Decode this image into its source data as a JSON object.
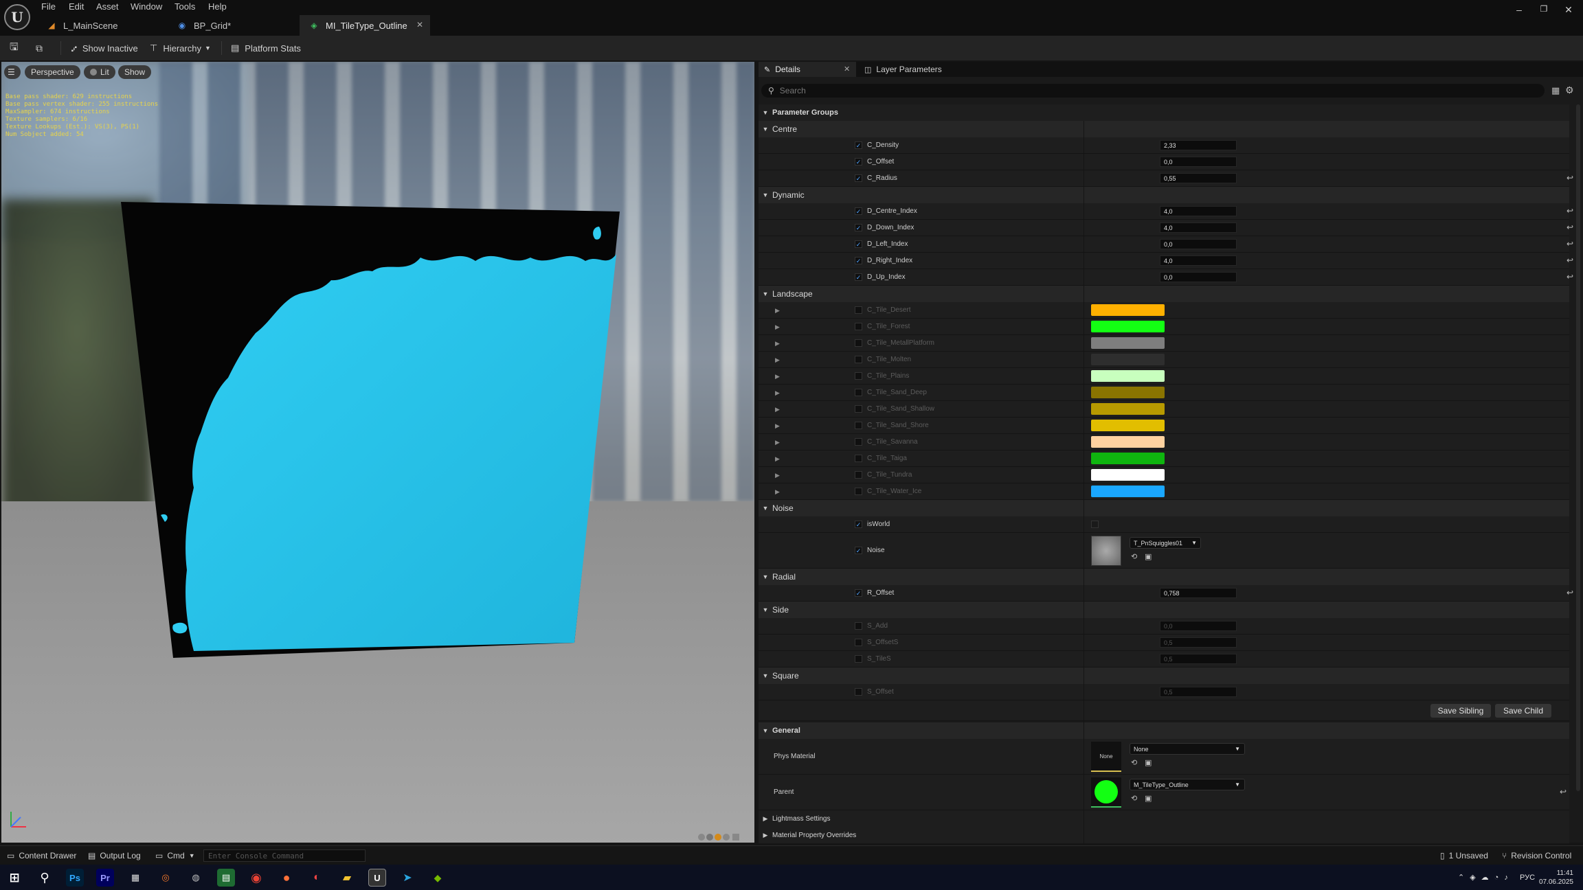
{
  "menu": [
    "File",
    "Edit",
    "Asset",
    "Window",
    "Tools",
    "Help"
  ],
  "doc_tabs": [
    {
      "label": "L_MainScene"
    },
    {
      "label": "BP_Grid*"
    },
    {
      "label": "MI_TileType_Outline",
      "active": true
    }
  ],
  "toolbar": {
    "show_inactive": "Show Inactive",
    "hierarchy": "Hierarchy",
    "platform_stats": "Platform Stats"
  },
  "viewport": {
    "perspective": "Perspective",
    "lit": "Lit",
    "show": "Show",
    "stats": [
      "Base pass shader: 629 instructions",
      "Base pass vertex shader: 255 instructions",
      "MaxSampler: 674 instructions",
      "Texture samplers: 6/16",
      "Texture Lookups (Est.): VS(3), PS(1)",
      "Num Sobject added: 54"
    ],
    "preview_color": "#27c3ea"
  },
  "details": {
    "tab_details": "Details",
    "tab_layer": "Layer Parameters",
    "search_placeholder": "Search",
    "parameter_groups": "Parameter Groups",
    "groups": [
      {
        "name": "Centre",
        "params": [
          {
            "name": "C_Density",
            "value": "2,33",
            "checked": true,
            "reset": false
          },
          {
            "name": "C_Offset",
            "value": "0,0",
            "checked": true,
            "reset": false
          },
          {
            "name": "C_Radius",
            "value": "0,55",
            "checked": true,
            "reset": true
          }
        ]
      },
      {
        "name": "Dynamic",
        "params": [
          {
            "name": "D_Centre_Index",
            "value": "4,0",
            "checked": true,
            "reset": true
          },
          {
            "name": "D_Down_Index",
            "value": "4,0",
            "checked": true,
            "reset": true
          },
          {
            "name": "D_Left_Index",
            "value": "0,0",
            "checked": true,
            "reset": true
          },
          {
            "name": "D_Right_Index",
            "value": "4,0",
            "checked": true,
            "reset": true
          },
          {
            "name": "D_Up_Index",
            "value": "0,0",
            "checked": true,
            "reset": true
          }
        ]
      },
      {
        "name": "Landscape",
        "colors": [
          {
            "name": "C_Tile_Desert",
            "color": "#ffb000"
          },
          {
            "name": "C_Tile_Forest",
            "color": "#13ff13"
          },
          {
            "name": "C_Tile_MetallPlatform",
            "color": "#7e7e7e"
          },
          {
            "name": "C_Tile_Molten",
            "color": "#2e2e2e"
          },
          {
            "name": "C_Tile_Plains",
            "color": "#c8ffbe"
          },
          {
            "name": "C_Tile_Sand_Deep",
            "color": "#8a7400"
          },
          {
            "name": "C_Tile_Sand_Shallow",
            "color": "#b79a00"
          },
          {
            "name": "C_Tile_Sand_Shore",
            "color": "#e2be00"
          },
          {
            "name": "C_Tile_Savanna",
            "color": "#ffd2a0"
          },
          {
            "name": "C_Tile_Taiga",
            "color": "#0fb50f"
          },
          {
            "name": "C_Tile_Tundra",
            "color": "#ffffff"
          },
          {
            "name": "C_Tile_Water_Ice",
            "color": "#1aa7ff"
          }
        ]
      },
      {
        "name": "Noise",
        "isworld": "isWorld",
        "noise": "Noise",
        "noise_texture": "T_PnSquiggles01"
      },
      {
        "name": "Radial",
        "params": [
          {
            "name": "R_Offset",
            "value": "0,758",
            "checked": true,
            "reset": true
          }
        ]
      },
      {
        "name": "Side",
        "params": [
          {
            "name": "S_Add",
            "value": "0,0",
            "checked": false,
            "reset": false
          },
          {
            "name": "S_OffsetS",
            "value": "0,5",
            "checked": false,
            "reset": false
          },
          {
            "name": "S_TileS",
            "value": "0,5",
            "checked": false,
            "reset": false
          }
        ]
      },
      {
        "name": "Square",
        "params": [
          {
            "name": "S_Offset",
            "value": "0,5",
            "checked": false,
            "reset": false
          }
        ]
      }
    ],
    "save_sibling": "Save Sibling",
    "save_child": "Save Child",
    "general": "General",
    "phys_material_label": "Phys Material",
    "phys_material_thumb": "None",
    "phys_material_value": "None",
    "parent_label": "Parent",
    "parent_value": "M_TileType_Outline",
    "lightmass": "Lightmass Settings",
    "mpo": "Material Property Overrides"
  },
  "statusbar": {
    "content_drawer": "Content Drawer",
    "output_log": "Output Log",
    "cmd": "Cmd",
    "console_placeholder": "Enter Console Command",
    "unsaved": "1 Unsaved",
    "revision": "Revision Control"
  },
  "taskbar": {
    "lang": "РУС",
    "time": "11:41",
    "date": "07.06.2025"
  }
}
